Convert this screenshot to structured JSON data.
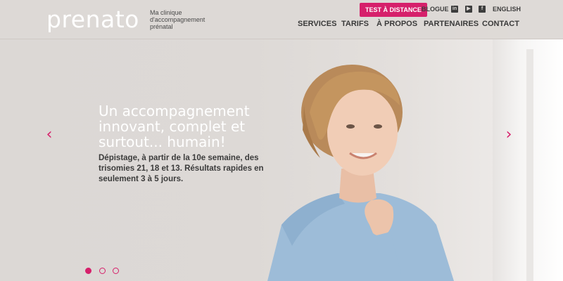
{
  "brand": {
    "logo_text": "prenato",
    "tagline": "Ma clinique d'accompagnement prénatal",
    "accent_color": "#d6206b"
  },
  "topbar": {
    "test_button": "TEST À DISTANCE",
    "blog_link": "BLOGUE",
    "social": [
      "linkedin-icon",
      "youtube-icon",
      "facebook-icon"
    ],
    "language_link": "ENGLISH"
  },
  "nav": {
    "items": [
      "SERVICES",
      "TARIFS",
      "À PROPOS",
      "PARTENAIRES",
      "CONTACT"
    ]
  },
  "slide": {
    "headline": "Un accompagnement innovant, complet et surtout...  humain!",
    "subtext": "Dépistage, à partir de la 10e semaine, des trisomies 21, 18 et 13. Résultats rapides en seulement 3 à 5 jours.",
    "prev_arrow": "‹",
    "next_arrow": "›"
  },
  "carousel": {
    "slide_count": 3,
    "active_index": 0
  }
}
